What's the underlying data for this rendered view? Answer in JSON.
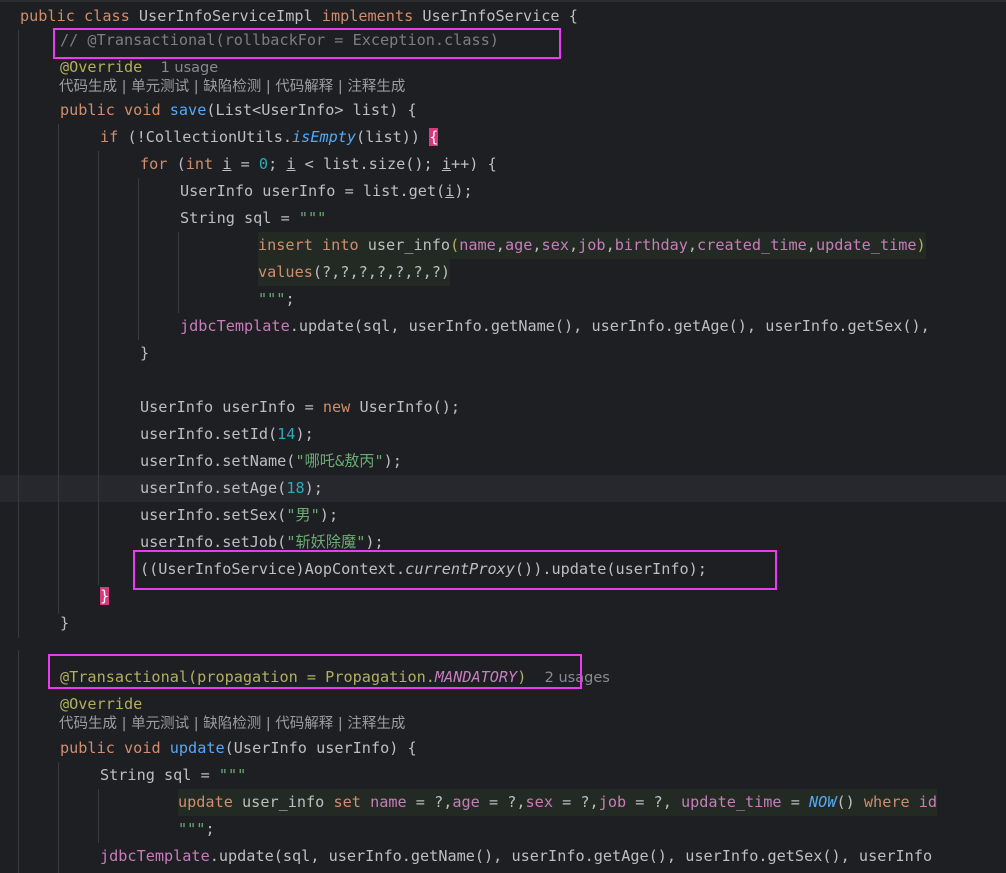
{
  "editor": {
    "highlight_color": "#e93cf0",
    "code": {
      "l1": {
        "kw1": "public",
        "kw2": "class",
        "cls": "UserInfoServiceImpl",
        "kw3": "implements",
        "iface": "UserInfoService",
        "brace": "{"
      },
      "l2": {
        "comment": "// @Transactional(rollbackFor = Exception.class)"
      },
      "l3": {
        "ann": "@Override",
        "usage": "1 usage"
      },
      "l4": {
        "lens": "代码生成 | 单元测试 | 缺陷检测 | 代码解释 | 注释生成"
      },
      "l5": {
        "kw1": "public",
        "kw2": "void",
        "fn": "save",
        "rest": "(List<UserInfo> list) {"
      },
      "l6": {
        "kw": "if",
        "a": " (!CollectionUtils.",
        "fn": "isEmpty",
        "b": "(list)) ",
        "brace": "{"
      },
      "l7": {
        "kw": "for",
        "a": " (",
        "kw2": "int",
        "v1": "i",
        "b": " = ",
        "n0": "0",
        "c": "; ",
        "v2": "i",
        "d": " < list.size(); ",
        "v3": "i",
        "e": "++) {"
      },
      "l8": {
        "a": "UserInfo userInfo = list.get(",
        "v": "i",
        "b": ");"
      },
      "l9": {
        "a": "String sql = ",
        "s": "\"\"\""
      },
      "l10": {
        "k1": "insert",
        "k2": "into",
        "t": "user_info",
        "p1": "(",
        "c1": "name",
        "c2": "age",
        "c3": "sex",
        "c4": "job",
        "c5": "birthday",
        "c6": "created_time",
        "c7": "update_time",
        "p2": ")"
      },
      "l11": {
        "k": "values",
        "rest": "(?,?,?,?,?,?,?)"
      },
      "l12": {
        "s": "\"\"\"",
        "end": ";"
      },
      "l13": {
        "a": "jdbcTemplate",
        "b": ".update(sql, userInfo.getName(), userInfo.getAge(), userInfo.getSex(),"
      },
      "l14": {
        "brace": "}"
      },
      "l16": {
        "a": "UserInfo userInfo = ",
        "kw": "new",
        "b": " UserInfo();"
      },
      "l17": {
        "a": "userInfo.setId(",
        "n": "14",
        "b": ");"
      },
      "l18": {
        "a": "userInfo.setName(",
        "s": "\"哪吒&敖丙\"",
        "b": ");"
      },
      "l19": {
        "a": "userInfo.setAge(",
        "n": "18",
        "b": ");"
      },
      "l20": {
        "a": "userInfo.setSex(",
        "s": "\"男\"",
        "b": ");"
      },
      "l21": {
        "a": "userInfo.setJob(",
        "s": "\"斩妖除魔\"",
        "b": ");"
      },
      "l22": {
        "a": "((UserInfoService)AopContext.",
        "fn": "currentProxy",
        "b": "()).update(userInfo);"
      },
      "l23": {
        "brace": "}"
      },
      "l24": {
        "brace": "}"
      },
      "l26": {
        "ann": "@Transactional",
        "a": "(propagation = Propagation.",
        "c": "MANDATORY",
        "b": ")",
        "usage": "2 usages"
      },
      "l27": {
        "ann": "@Override"
      },
      "l28": {
        "lens": "代码生成 | 单元测试 | 缺陷检测 | 代码解释 | 注释生成"
      },
      "l29": {
        "kw1": "public",
        "kw2": "void",
        "fn": "update",
        "rest": "(UserInfo userInfo) {"
      },
      "l30": {
        "a": "String sql = ",
        "s": "\"\"\""
      },
      "l31": {
        "k1": "update",
        "t": "user_info",
        "k2": "set",
        "c1": "name",
        "e1": " = ?,",
        "c2": "age",
        "e2": " = ?,",
        "c3": "sex",
        "e3": " = ?,",
        "c4": "job",
        "e4": " = ?, ",
        "c5": "update_time",
        "e5": " = ",
        "fn": "NOW",
        "e6": "() ",
        "k3": "where",
        "c6": "id"
      },
      "l32": {
        "s": "\"\"\"",
        "end": ";"
      },
      "l33": {
        "a": "jdbcTemplate",
        "b": ".update(sql, userInfo.getName(), userInfo.getAge(), userInfo.getSex(), userInfo"
      }
    }
  }
}
